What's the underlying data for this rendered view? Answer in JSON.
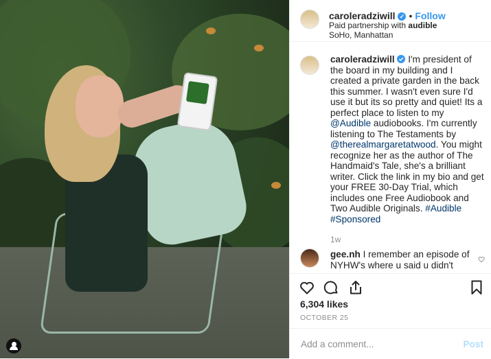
{
  "post": {
    "username": "caroleradziwill",
    "follow_label": "Follow",
    "paid_partnership_prefix": "Paid partnership with",
    "partner": "audible",
    "location": "SoHo, Manhattan",
    "caption_parts": [
      "I'm president of the board in my building and I created a private garden in the back this summer. I wasn't even sure I'd use it but its so pretty and quiet! Its a perfect place to listen to my ",
      "@Audible",
      " audiobooks. I'm currently listening to The Testaments by ",
      "@therealmargaretatwood",
      ". You might recognize her as the author of The Handmaid's Tale, she's a brilliant writer. Click the link in my bio and get your FREE 30-Day Trial, which includes one Free Audiobook and Two Audible Originals. ",
      "#Audible",
      " ",
      "#Sponsored"
    ],
    "caption_time": "1w",
    "likes": "6,304 likes",
    "date": "OCTOBER 25"
  },
  "comment": {
    "username": "gee.nh",
    "text": "I remember an episode of NYHW's where u said u didn't"
  },
  "add_comment": {
    "placeholder": "Add a comment...",
    "post_label": "Post"
  },
  "colors": {
    "link_blue": "#3897f0",
    "hashtag_blue": "#00376b",
    "muted_gray": "#8e8e8e",
    "post_disabled": "#b2dffc"
  },
  "icons": {
    "verified": "verified-badge-icon",
    "like": "heart-icon",
    "comment": "comment-bubble-icon",
    "share": "share-upload-icon",
    "save": "bookmark-icon",
    "comment_like": "small-heart-icon",
    "user_tag": "user-tag-icon"
  }
}
